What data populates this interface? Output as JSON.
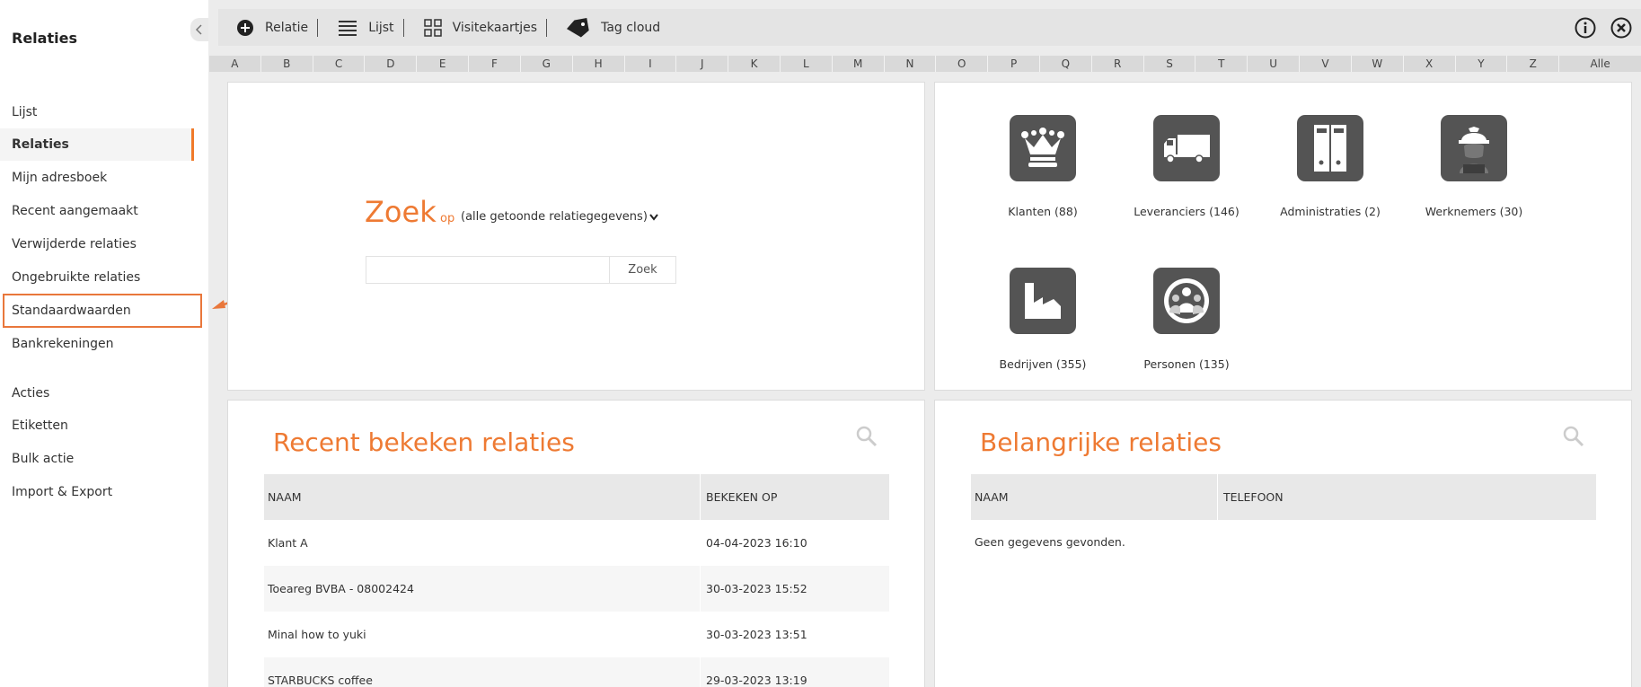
{
  "sidebar": {
    "title": "Relaties",
    "groups": [
      [
        "Lijst",
        "Relaties",
        "Mijn adresboek",
        "Recent aangemaakt",
        "Verwijderde relaties",
        "Ongebruikte relaties",
        "Standaardwaarden",
        "Bankrekeningen"
      ],
      [
        "Acties",
        "Etiketten",
        "Bulk actie",
        "Import & Export"
      ]
    ],
    "active": "Relaties",
    "highlighted": "Standaardwaarden"
  },
  "toolbar": {
    "relatie": "Relatie",
    "lijst": "Lijst",
    "visitekaartjes": "Visitekaartjes",
    "tagcloud": "Tag cloud"
  },
  "alphabet": [
    "A",
    "B",
    "C",
    "D",
    "E",
    "F",
    "G",
    "H",
    "I",
    "J",
    "K",
    "L",
    "M",
    "N",
    "O",
    "P",
    "Q",
    "R",
    "S",
    "T",
    "U",
    "V",
    "W",
    "X",
    "Y",
    "Z",
    "Alle"
  ],
  "search": {
    "title": "Zoek",
    "op": "op",
    "scope": "(alle getoonde relatiegegevens)",
    "input_value": "",
    "button": "Zoek"
  },
  "categories": [
    {
      "label": "Klanten (88)",
      "icon": "crown-icon"
    },
    {
      "label": "Leveranciers (146)",
      "icon": "truck-icon"
    },
    {
      "label": "Administraties (2)",
      "icon": "binders-icon"
    },
    {
      "label": "Werknemers (30)",
      "icon": "worker-icon"
    },
    {
      "label": "Bedrijven (355)",
      "icon": "factory-icon"
    },
    {
      "label": "Personen (135)",
      "icon": "people-icon"
    }
  ],
  "recent": {
    "title": "Recent bekeken relaties",
    "headers": [
      "NAAM",
      "BEKEKEN OP"
    ],
    "rows": [
      [
        "Klant A",
        "04-04-2023 16:10"
      ],
      [
        "Toeareg BVBA - 08002424",
        "30-03-2023 15:52"
      ],
      [
        "Minal how to yuki",
        "30-03-2023 13:51"
      ],
      [
        "STARBUCKS coffee",
        "29-03-2023 13:19"
      ]
    ]
  },
  "important": {
    "title": "Belangrijke relaties",
    "headers": [
      "NAAM",
      "TELEFOON"
    ],
    "empty": "Geen gegevens gevonden."
  },
  "colors": {
    "accent": "#ee7a33",
    "tile": "#545454"
  }
}
